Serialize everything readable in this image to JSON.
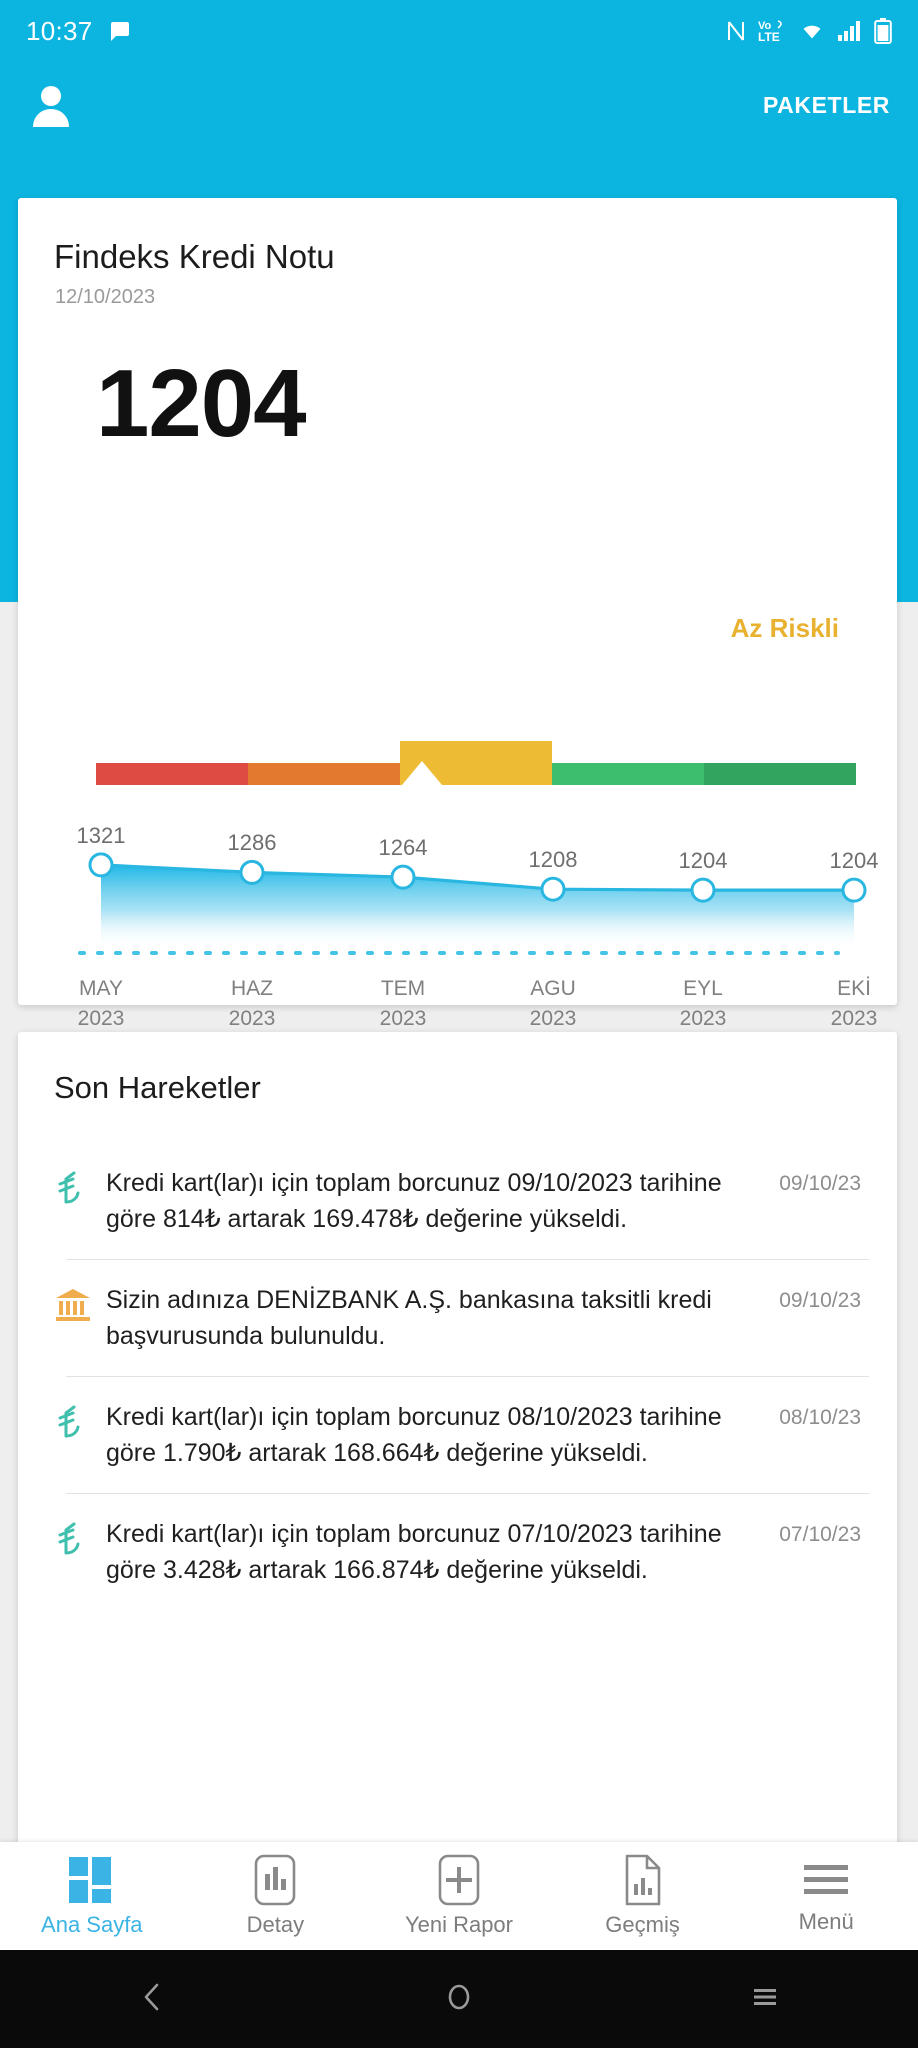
{
  "statusbar": {
    "time": "10:37",
    "icons": [
      "chat-bubble-icon",
      "nfc-icon",
      "volte-icon",
      "wifi-icon",
      "cellular-signal-icon",
      "battery-icon"
    ]
  },
  "appbar": {
    "avatar_icon": "person-icon",
    "packages_label": "PAKETLER"
  },
  "score_card": {
    "title": "Findeks Kredi Notu",
    "date": "12/10/2023",
    "score": "1204",
    "risk_label": "Az Riskli",
    "risk_color": "#e8b130",
    "risk_segments": [
      {
        "name": "cok-riskli",
        "color": "#dd4b43",
        "active": false
      },
      {
        "name": "riskli",
        "color": "#e3792e",
        "active": false
      },
      {
        "name": "az-riskli",
        "color": "#eebb34",
        "active": true
      },
      {
        "name": "iyi",
        "color": "#3dbe6f",
        "active": false
      },
      {
        "name": "cok-iyi",
        "color": "#32a45f",
        "active": false
      }
    ]
  },
  "chart_data": {
    "type": "line",
    "title": "",
    "xlabel": "",
    "ylabel": "",
    "categories": [
      "MAY\n2023",
      "HAZ\n2023",
      "TEM\n2023",
      "AGU\n2023",
      "EYL\n2023",
      "EKİ\n2023"
    ],
    "month_labels": [
      "MAY",
      "HAZ",
      "TEM",
      "AGU",
      "EYL",
      "EKİ"
    ],
    "year_labels": [
      "2023",
      "2023",
      "2023",
      "2023",
      "2023",
      "2023"
    ],
    "values": [
      1321,
      1286,
      1264,
      1208,
      1204,
      1204
    ],
    "point_labels": [
      "1321",
      "1286",
      "1264",
      "1208",
      "1204",
      "1204"
    ],
    "ylim": [
      1150,
      1360
    ],
    "grid": false,
    "legend": "none",
    "line_color": "#29b6e0",
    "area_gradient": [
      "#2ec0e8",
      "#ffffff"
    ],
    "marker": "circle-open"
  },
  "activity": {
    "title": "Son Hareketler",
    "items": [
      {
        "icon": "lira-icon",
        "icon_color": "#3fbfae",
        "text": "Kredi kart(lar)ı için toplam borcunuz 09/10/2023 tarihine göre 814₺ artarak 169.478₺ değerine yükseldi.",
        "date": "09/10/23"
      },
      {
        "icon": "bank-icon",
        "icon_color": "#f0ad4e",
        "text": "Sizin adınıza DENİZBANK A.Ş. bankasına taksitli kredi başvurusunda bulunuldu.",
        "date": "09/10/23"
      },
      {
        "icon": "lira-icon",
        "icon_color": "#3fbfae",
        "text": "Kredi kart(lar)ı için toplam borcunuz 08/10/2023 tarihine göre 1.790₺ artarak 168.664₺ değerine yükseldi.",
        "date": "08/10/23"
      },
      {
        "icon": "lira-icon",
        "icon_color": "#3fbfae",
        "text": "Kredi kart(lar)ı için toplam borcunuz 07/10/2023 tarihine göre 3.428₺ artarak 166.874₺ değerine yükseldi.",
        "date": "07/10/23"
      }
    ]
  },
  "tabbar": {
    "active_color": "#3bb4e5",
    "items": [
      {
        "icon": "home-grid-icon",
        "label": "Ana Sayfa",
        "active": true
      },
      {
        "icon": "bar-chart-icon",
        "label": "Detay",
        "active": false
      },
      {
        "icon": "plus-icon",
        "label": "Yeni Rapor",
        "active": false
      },
      {
        "icon": "document-chart-icon",
        "label": "Geçmiş",
        "active": false
      },
      {
        "icon": "hamburger-icon",
        "label": "Menü",
        "active": false
      }
    ]
  },
  "navbar": {
    "back": "back-chevron-icon",
    "home": "home-circle-icon",
    "recents": "recents-icon"
  }
}
